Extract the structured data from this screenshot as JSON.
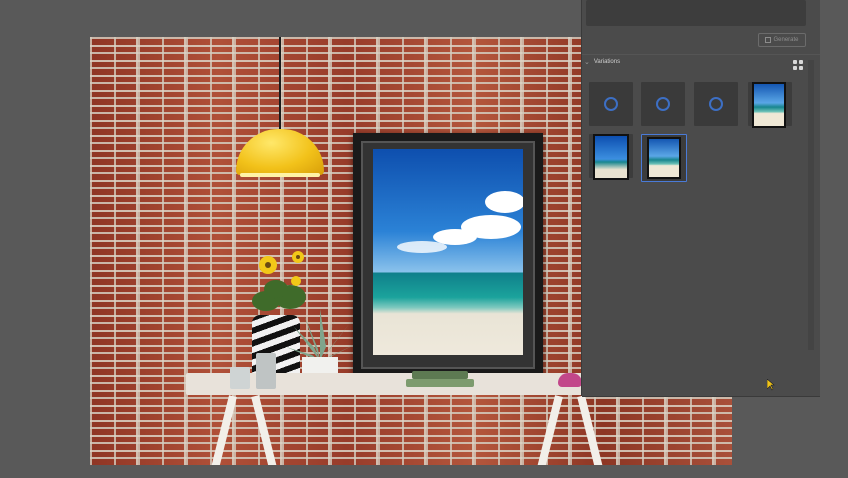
{
  "panel": {
    "generate_label": "Generate",
    "variations_title": "Variations",
    "collapse_icon": "chevron-down-icon",
    "view_icon": "grid-view-icon",
    "thumbnails": [
      {
        "state": "loading"
      },
      {
        "state": "loading"
      },
      {
        "state": "loading"
      },
      {
        "state": "image"
      },
      {
        "state": "image"
      },
      {
        "state": "image",
        "selected": true
      }
    ]
  },
  "colors": {
    "app_background": "#595959",
    "panel_background": "#4b4b4b",
    "accent": "#4a7bd8",
    "spinner": "#3d6fc4"
  }
}
